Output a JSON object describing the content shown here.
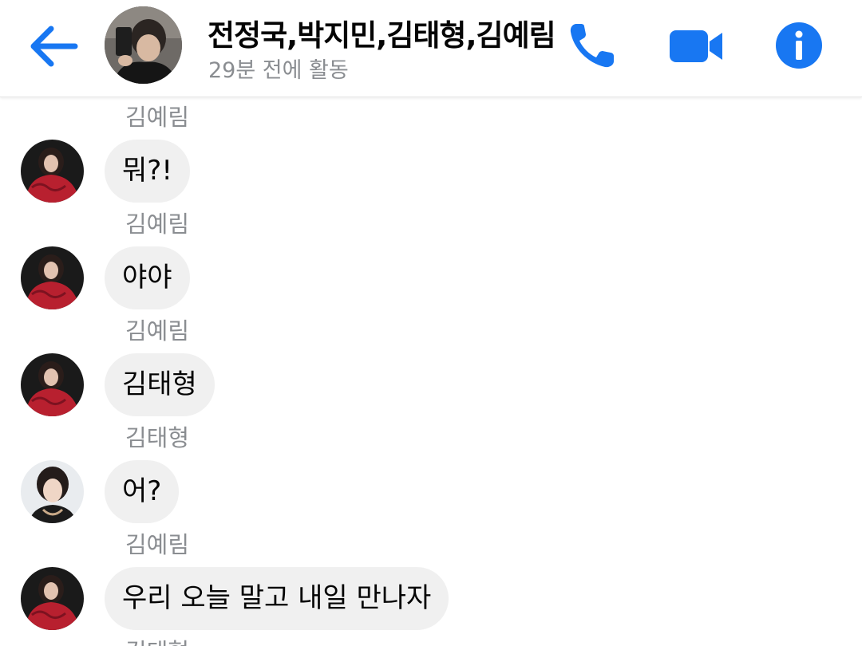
{
  "header": {
    "title": "전정국,박지민,김태형,김예림",
    "status": "29분 전에 활동",
    "accent_color": "#1877f2",
    "icons": [
      "back-arrow-icon",
      "phone-icon",
      "video-camera-icon",
      "info-icon"
    ]
  },
  "messages": [
    {
      "sender": "김예림",
      "text": "뭐?!",
      "avatar": "yerim"
    },
    {
      "sender": "김예림",
      "text": "야야",
      "avatar": "yerim"
    },
    {
      "sender": "김예림",
      "text": "김태형",
      "avatar": "yerim"
    },
    {
      "sender": "김태형",
      "text": "어?",
      "avatar": "taehyung"
    },
    {
      "sender": "김예림",
      "text": "우리 오늘 말고 내일 만나자",
      "avatar": "yerim"
    }
  ],
  "top_sender": "김예림",
  "bottom_sender": "김태형",
  "colors": {
    "bubble_bg": "#f0f0f0",
    "sender_text": "#8a8d91"
  }
}
